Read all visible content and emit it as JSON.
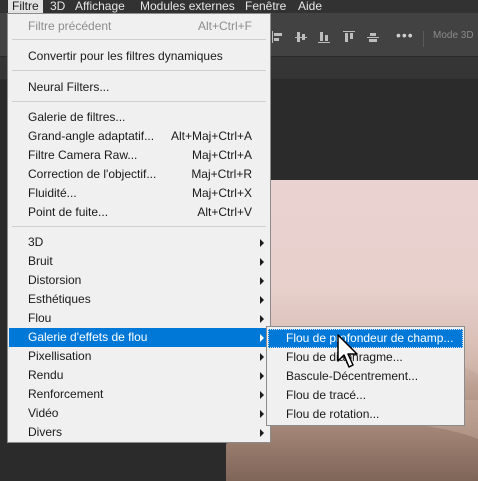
{
  "menubar": {
    "items": [
      "Filtre",
      "3D",
      "Affichage",
      "Modules externes",
      "Fenêtre",
      "Aide"
    ]
  },
  "optionsbar": {
    "more_label": "•••",
    "mode3d_label": "Mode 3D"
  },
  "filter_menu": {
    "items": [
      {
        "label": "Filtre précédent",
        "shortcut": "Alt+Ctrl+F"
      },
      {
        "label": "Convertir pour les filtres dynamiques",
        "shortcut": ""
      },
      {
        "label": "Neural Filters...",
        "shortcut": ""
      },
      {
        "label": "Galerie de filtres...",
        "shortcut": ""
      },
      {
        "label": "Grand-angle adaptatif...",
        "shortcut": "Alt+Maj+Ctrl+A"
      },
      {
        "label": "Filtre Camera Raw...",
        "shortcut": "Maj+Ctrl+A"
      },
      {
        "label": "Correction de l'objectif...",
        "shortcut": "Maj+Ctrl+R"
      },
      {
        "label": "Fluidité...",
        "shortcut": "Maj+Ctrl+X"
      },
      {
        "label": "Point de fuite...",
        "shortcut": "Alt+Ctrl+V"
      },
      {
        "label": "3D",
        "shortcut": ""
      },
      {
        "label": "Bruit",
        "shortcut": ""
      },
      {
        "label": "Distorsion",
        "shortcut": ""
      },
      {
        "label": "Esthétiques",
        "shortcut": ""
      },
      {
        "label": "Flou",
        "shortcut": ""
      },
      {
        "label": "Galerie d'effets de flou",
        "shortcut": ""
      },
      {
        "label": "Pixellisation",
        "shortcut": ""
      },
      {
        "label": "Rendu",
        "shortcut": ""
      },
      {
        "label": "Renforcement",
        "shortcut": ""
      },
      {
        "label": "Vidéo",
        "shortcut": ""
      },
      {
        "label": "Divers",
        "shortcut": ""
      }
    ]
  },
  "blur_submenu": {
    "items": [
      {
        "label": "Flou de profondeur de champ..."
      },
      {
        "label": "Flou de diaphragme..."
      },
      {
        "label": "Bascule-Décentrement..."
      },
      {
        "label": "Flou de tracé..."
      },
      {
        "label": "Flou de rotation..."
      }
    ]
  },
  "colors": {
    "highlight": "#0078d7",
    "menu_bg": "#f0f0f0",
    "app_bg": "#2b2b2b"
  }
}
